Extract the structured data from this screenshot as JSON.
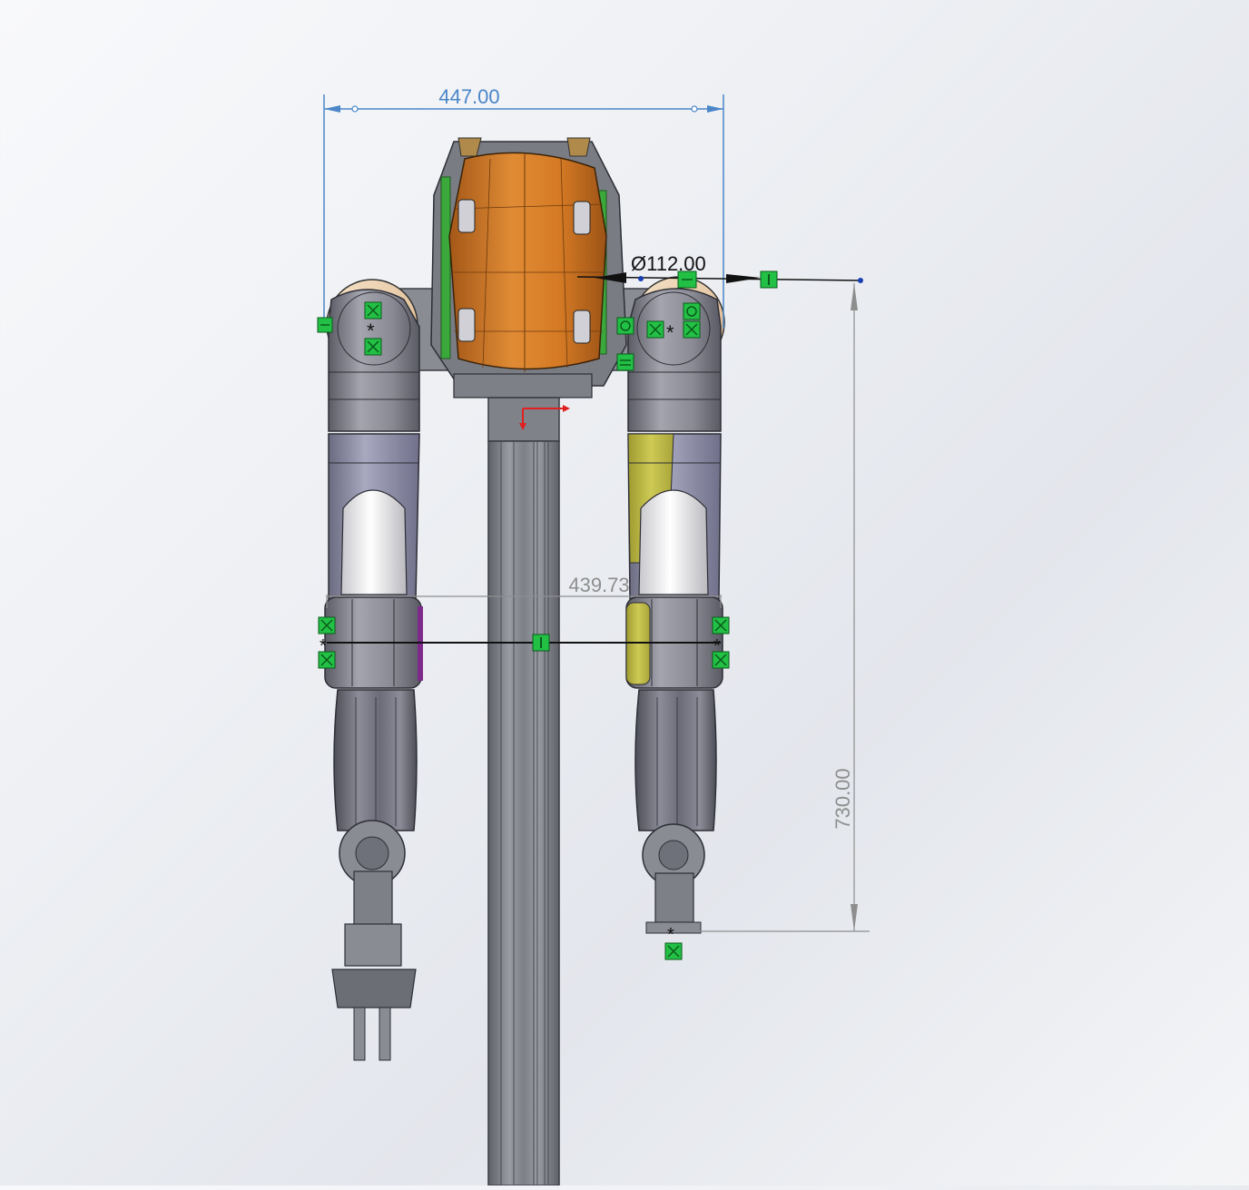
{
  "dimensions": {
    "width_top": "447.00",
    "diameter": "Ø112.00",
    "elbow_span": "439.73",
    "height": "730.00"
  },
  "colors": {
    "viewport_bg": "#eef0f4",
    "head_orange": "#d07a26",
    "arm_grey": "#8d8d97",
    "sketch_green": "#22c044",
    "dim_blue": "#4a86c8",
    "highlight_yellow": "#c2bd45",
    "axis_red": "#e02020"
  },
  "icons": {
    "coincident": "coincident-constraint-icon",
    "horizontal": "horizontal-constraint-icon",
    "concentric": "concentric-constraint-icon",
    "origin": "origin-triad-icon"
  }
}
